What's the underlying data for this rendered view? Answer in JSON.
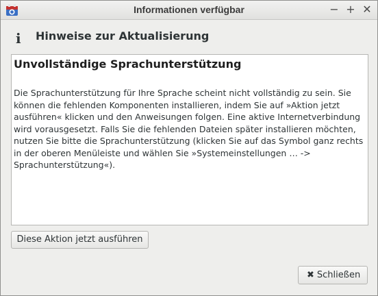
{
  "window": {
    "title": "Informationen verfügbar",
    "minimize_glyph": "−",
    "maximize_glyph": "+",
    "close_glyph": "✕"
  },
  "header": {
    "icon_glyph": "i",
    "title": "Hinweise zur Aktualisierung"
  },
  "content": {
    "heading": "Unvollständige Sprachunterstützung",
    "body": "Die Sprachunterstützung für Ihre Sprache scheint nicht vollständig zu sein. Sie können die fehlenden Komponenten installieren, indem Sie auf »Aktion jetzt ausführen« klicken und den Anweisungen folgen. Eine aktive Internetverbindung wird vorausgesetzt. Falls Sie die fehlenden Dateien später installieren möchten, nutzen Sie bitte die Sprachunterstützung (klicken Sie auf das Symbol ganz rechts in der oberen Menüleiste und wählen Sie »Systemeinstellungen … -> Sprachunterstützung«)."
  },
  "buttons": {
    "run_label": "Diese Aktion jetzt ausführen",
    "close_label": "Schließen",
    "close_glyph": "✖"
  }
}
